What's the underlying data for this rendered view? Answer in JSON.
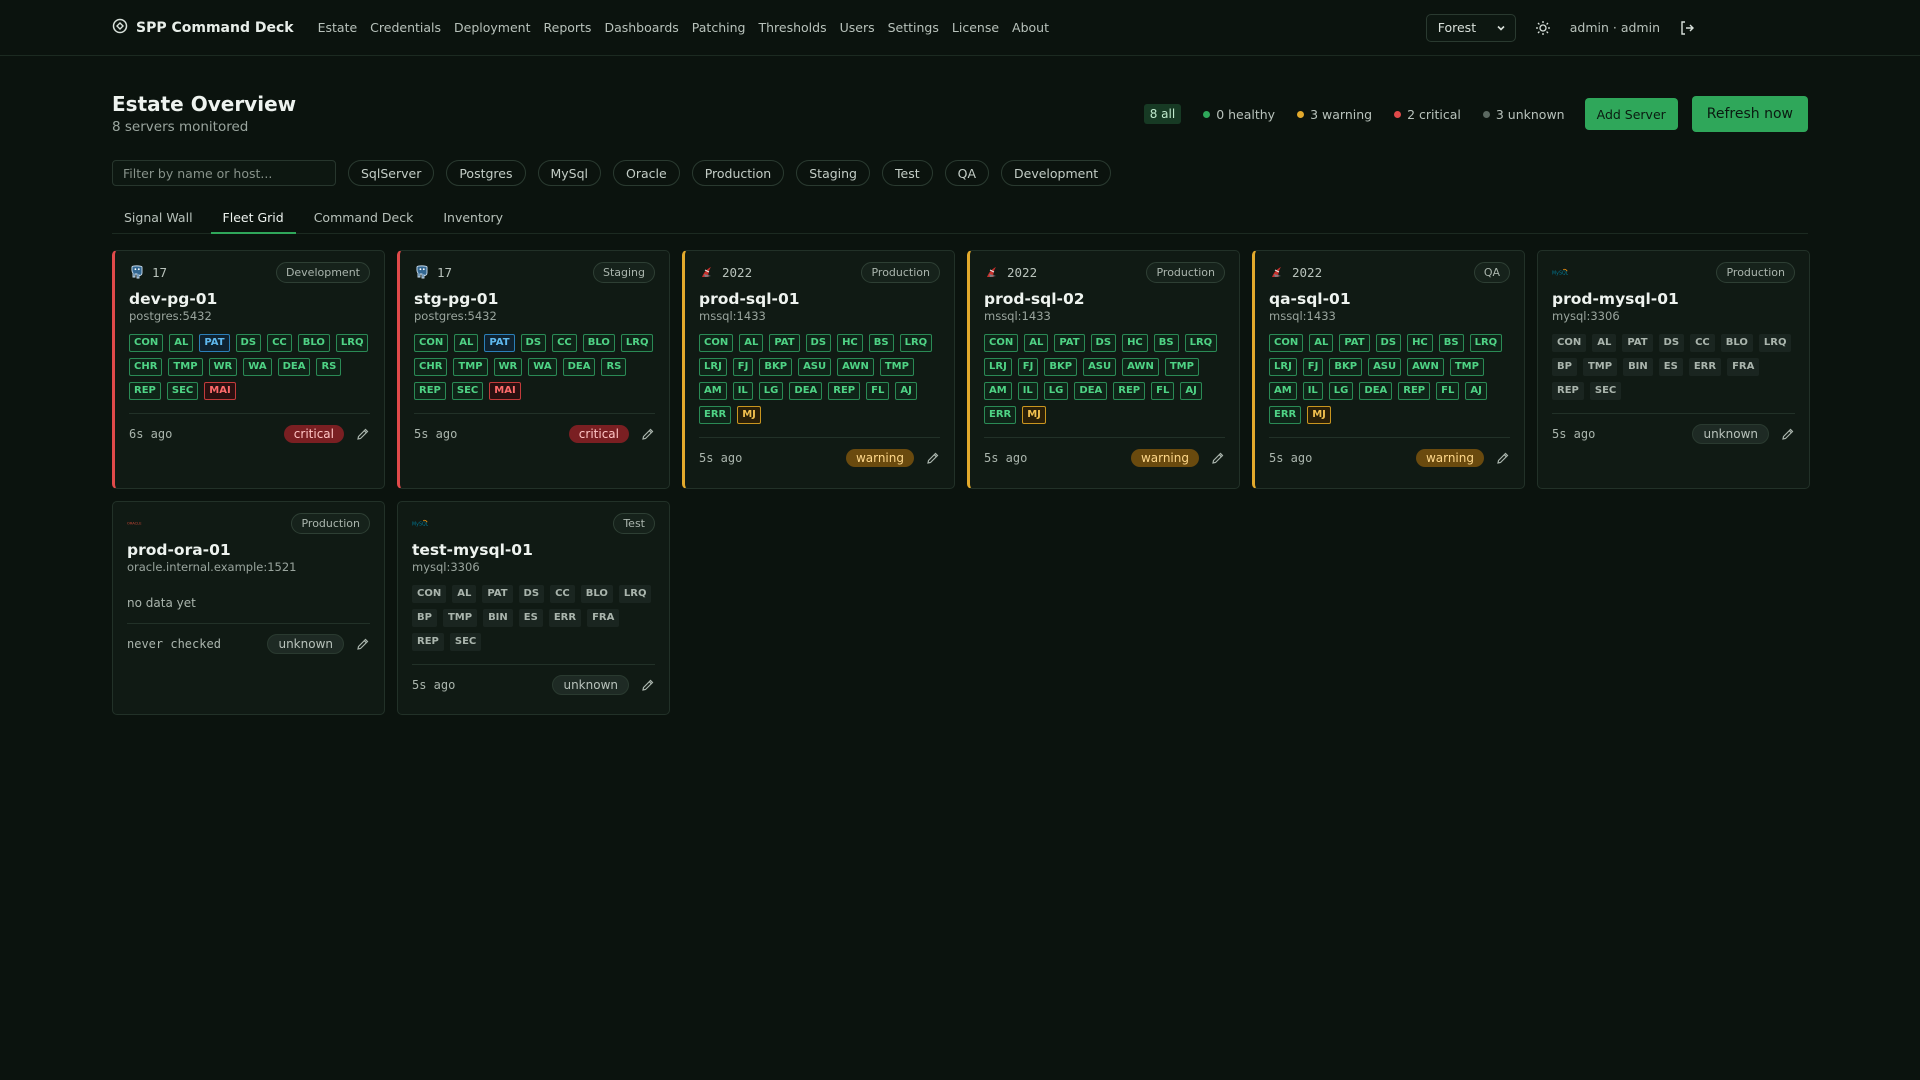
{
  "app": {
    "brand": "SPP Command Deck",
    "nav": [
      "Estate",
      "Credentials",
      "Deployment",
      "Reports",
      "Dashboards",
      "Patching",
      "Thresholds",
      "Users",
      "Settings",
      "License",
      "About"
    ],
    "theme": "Forest",
    "user": "admin · admin"
  },
  "page": {
    "title": "Estate Overview",
    "subtitle": "8 servers monitored",
    "summary": {
      "all": "8 all",
      "healthy": "0 healthy",
      "warning": "3 warning",
      "critical": "2 critical",
      "unknown": "3 unknown"
    },
    "add_label": "Add Server",
    "refresh_label": "Refresh now"
  },
  "filters": {
    "placeholder": "Filter by name or host...",
    "pills": [
      "SqlServer",
      "Postgres",
      "MySql",
      "Oracle",
      "Production",
      "Staging",
      "Test",
      "QA",
      "Development"
    ]
  },
  "tabs": [
    "Signal Wall",
    "Fleet Grid",
    "Command Deck",
    "Inventory"
  ],
  "active_tab": "Fleet Grid",
  "colors": {
    "accent": "#2fa75a",
    "critical": "#e04a4a",
    "warning": "#e2a92c",
    "healthy": "#2fa75a",
    "unknown": "#5b6860"
  },
  "servers": [
    {
      "engine_icon": "postgres-icon",
      "version": "17",
      "env": "Development",
      "name": "dev-pg-01",
      "host": "postgres:5432",
      "ago": "6s ago",
      "status": "critical",
      "codes": [
        [
          "CON",
          "g"
        ],
        [
          "AL",
          "g"
        ],
        [
          "PAT",
          "b"
        ],
        [
          "DS",
          "g"
        ],
        [
          "CC",
          "g"
        ],
        [
          "BLO",
          "g"
        ],
        [
          "LRQ",
          "g"
        ],
        [
          "CHR",
          "g"
        ],
        [
          "TMP",
          "g"
        ],
        [
          "WR",
          "g"
        ],
        [
          "WA",
          "g"
        ],
        [
          "DEA",
          "g"
        ],
        [
          "RS",
          "g"
        ],
        [
          "REP",
          "g"
        ],
        [
          "SEC",
          "g"
        ],
        [
          "MAI",
          "r"
        ]
      ]
    },
    {
      "engine_icon": "postgres-icon",
      "version": "17",
      "env": "Staging",
      "name": "stg-pg-01",
      "host": "postgres:5432",
      "ago": "5s ago",
      "status": "critical",
      "codes": [
        [
          "CON",
          "g"
        ],
        [
          "AL",
          "g"
        ],
        [
          "PAT",
          "b"
        ],
        [
          "DS",
          "g"
        ],
        [
          "CC",
          "g"
        ],
        [
          "BLO",
          "g"
        ],
        [
          "LRQ",
          "g"
        ],
        [
          "CHR",
          "g"
        ],
        [
          "TMP",
          "g"
        ],
        [
          "WR",
          "g"
        ],
        [
          "WA",
          "g"
        ],
        [
          "DEA",
          "g"
        ],
        [
          "RS",
          "g"
        ],
        [
          "REP",
          "g"
        ],
        [
          "SEC",
          "g"
        ],
        [
          "MAI",
          "r"
        ]
      ]
    },
    {
      "engine_icon": "sqlserver-icon",
      "version": "2022",
      "env": "Production",
      "name": "prod-sql-01",
      "host": "mssql:1433",
      "ago": "5s ago",
      "status": "warning",
      "codes": [
        [
          "CON",
          "g"
        ],
        [
          "AL",
          "g"
        ],
        [
          "PAT",
          "g"
        ],
        [
          "DS",
          "g"
        ],
        [
          "HC",
          "g"
        ],
        [
          "BS",
          "g"
        ],
        [
          "LRQ",
          "g"
        ],
        [
          "LRJ",
          "g"
        ],
        [
          "FJ",
          "g"
        ],
        [
          "BKP",
          "g"
        ],
        [
          "ASU",
          "g"
        ],
        [
          "AWN",
          "g"
        ],
        [
          "TMP",
          "g"
        ],
        [
          "AM",
          "g"
        ],
        [
          "IL",
          "g"
        ],
        [
          "LG",
          "g"
        ],
        [
          "DEA",
          "g"
        ],
        [
          "REP",
          "g"
        ],
        [
          "FL",
          "g"
        ],
        [
          "AJ",
          "g"
        ],
        [
          "ERR",
          "g"
        ],
        [
          "MJ",
          "y"
        ]
      ]
    },
    {
      "engine_icon": "sqlserver-icon",
      "version": "2022",
      "env": "Production",
      "name": "prod-sql-02",
      "host": "mssql:1433",
      "ago": "5s ago",
      "status": "warning",
      "codes": [
        [
          "CON",
          "g"
        ],
        [
          "AL",
          "g"
        ],
        [
          "PAT",
          "g"
        ],
        [
          "DS",
          "g"
        ],
        [
          "HC",
          "g"
        ],
        [
          "BS",
          "g"
        ],
        [
          "LRQ",
          "g"
        ],
        [
          "LRJ",
          "g"
        ],
        [
          "FJ",
          "g"
        ],
        [
          "BKP",
          "g"
        ],
        [
          "ASU",
          "g"
        ],
        [
          "AWN",
          "g"
        ],
        [
          "TMP",
          "g"
        ],
        [
          "AM",
          "g"
        ],
        [
          "IL",
          "g"
        ],
        [
          "LG",
          "g"
        ],
        [
          "DEA",
          "g"
        ],
        [
          "REP",
          "g"
        ],
        [
          "FL",
          "g"
        ],
        [
          "AJ",
          "g"
        ],
        [
          "ERR",
          "g"
        ],
        [
          "MJ",
          "y"
        ]
      ]
    },
    {
      "engine_icon": "sqlserver-icon",
      "version": "2022",
      "env": "QA",
      "name": "qa-sql-01",
      "host": "mssql:1433",
      "ago": "5s ago",
      "status": "warning",
      "codes": [
        [
          "CON",
          "g"
        ],
        [
          "AL",
          "g"
        ],
        [
          "PAT",
          "g"
        ],
        [
          "DS",
          "g"
        ],
        [
          "HC",
          "g"
        ],
        [
          "BS",
          "g"
        ],
        [
          "LRQ",
          "g"
        ],
        [
          "LRJ",
          "g"
        ],
        [
          "FJ",
          "g"
        ],
        [
          "BKP",
          "g"
        ],
        [
          "ASU",
          "g"
        ],
        [
          "AWN",
          "g"
        ],
        [
          "TMP",
          "g"
        ],
        [
          "AM",
          "g"
        ],
        [
          "IL",
          "g"
        ],
        [
          "LG",
          "g"
        ],
        [
          "DEA",
          "g"
        ],
        [
          "REP",
          "g"
        ],
        [
          "FL",
          "g"
        ],
        [
          "AJ",
          "g"
        ],
        [
          "ERR",
          "g"
        ],
        [
          "MJ",
          "y"
        ]
      ]
    },
    {
      "engine_icon": "mysql-icon",
      "version": "",
      "env": "Production",
      "name": "prod-mysql-01",
      "host": "mysql:3306",
      "ago": "5s ago",
      "status": "unknown",
      "codes": [
        [
          "CON",
          "n"
        ],
        [
          "AL",
          "n"
        ],
        [
          "PAT",
          "n"
        ],
        [
          "DS",
          "n"
        ],
        [
          "CC",
          "n"
        ],
        [
          "BLO",
          "n"
        ],
        [
          "LRQ",
          "n"
        ],
        [
          "BP",
          "n"
        ],
        [
          "TMP",
          "n"
        ],
        [
          "BIN",
          "n"
        ],
        [
          "ES",
          "n"
        ],
        [
          "ERR",
          "n"
        ],
        [
          "FRA",
          "n"
        ],
        [
          "REP",
          "n"
        ],
        [
          "SEC",
          "n"
        ]
      ]
    },
    {
      "engine_icon": "oracle-icon",
      "version": "",
      "env": "Production",
      "name": "prod-ora-01",
      "host": "oracle.internal.example:1521",
      "ago": "never checked",
      "status": "unknown",
      "no_data": "no data yet",
      "codes": []
    },
    {
      "engine_icon": "mysql-icon",
      "version": "",
      "env": "Test",
      "name": "test-mysql-01",
      "host": "mysql:3306",
      "ago": "5s ago",
      "status": "unknown",
      "codes": [
        [
          "CON",
          "n"
        ],
        [
          "AL",
          "n"
        ],
        [
          "PAT",
          "n"
        ],
        [
          "DS",
          "n"
        ],
        [
          "CC",
          "n"
        ],
        [
          "BLO",
          "n"
        ],
        [
          "LRQ",
          "n"
        ],
        [
          "BP",
          "n"
        ],
        [
          "TMP",
          "n"
        ],
        [
          "BIN",
          "n"
        ],
        [
          "ES",
          "n"
        ],
        [
          "ERR",
          "n"
        ],
        [
          "FRA",
          "n"
        ],
        [
          "REP",
          "n"
        ],
        [
          "SEC",
          "n"
        ]
      ]
    }
  ]
}
